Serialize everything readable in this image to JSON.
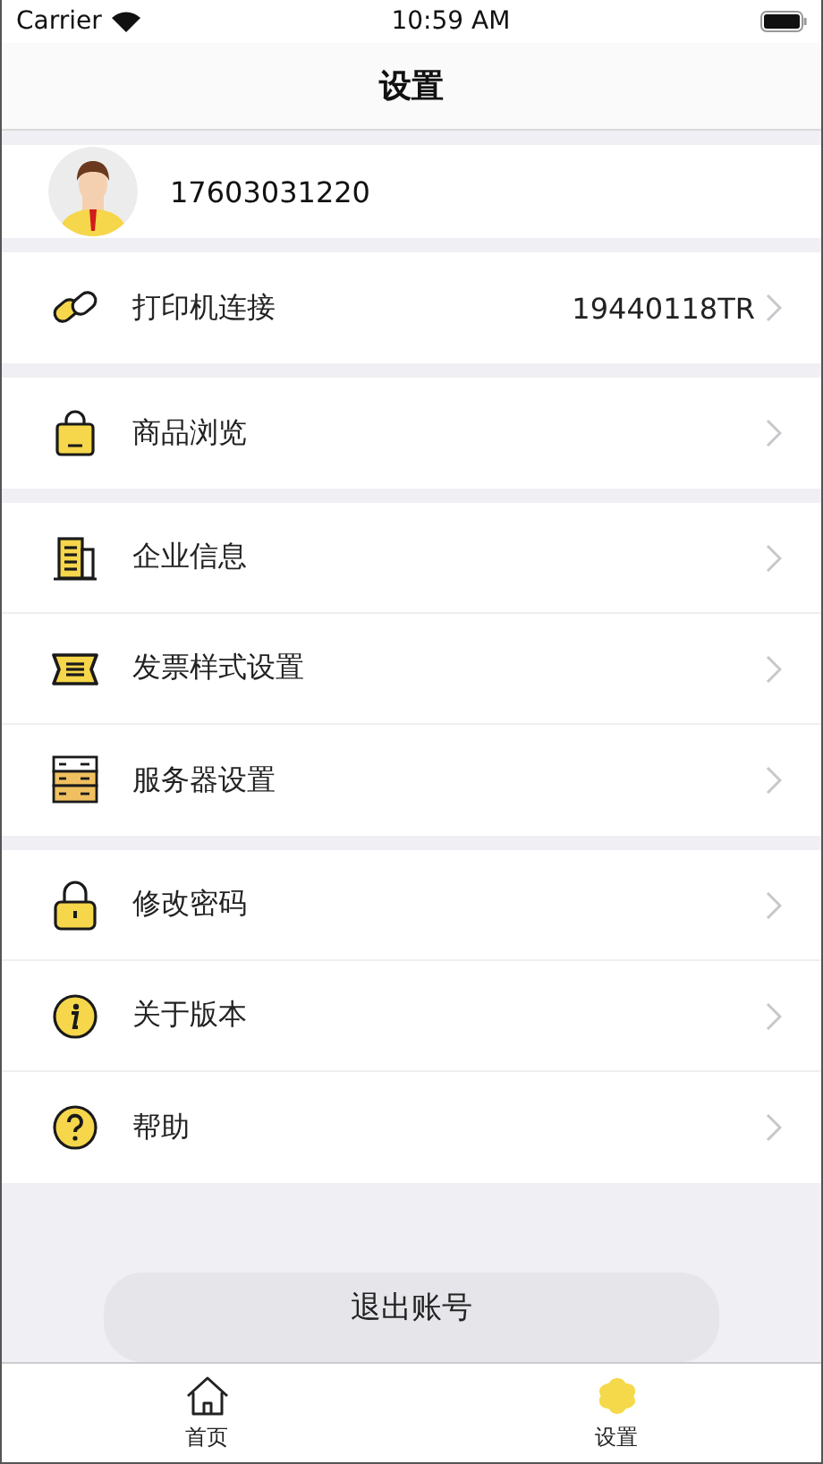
{
  "status_bar": {
    "carrier": "Carrier",
    "time": "10:59 AM"
  },
  "nav": {
    "title": "设置"
  },
  "profile": {
    "phone": "17603031220"
  },
  "sections": [
    {
      "rows": [
        {
          "label": "打印机连接",
          "value": "19440118TR"
        }
      ]
    },
    {
      "rows": [
        {
          "label": "商品浏览"
        }
      ]
    },
    {
      "rows": [
        {
          "label": "企业信息"
        },
        {
          "label": "发票样式设置"
        },
        {
          "label": "服务器设置"
        }
      ]
    },
    {
      "rows": [
        {
          "label": "修改密码"
        },
        {
          "label": "关于版本"
        },
        {
          "label": "帮助"
        }
      ]
    }
  ],
  "logout": {
    "label": "退出账号"
  },
  "tab_bar": [
    {
      "label": "首页",
      "kind": "home",
      "selected": false
    },
    {
      "label": "设置",
      "kind": "settings",
      "selected": true
    }
  ]
}
